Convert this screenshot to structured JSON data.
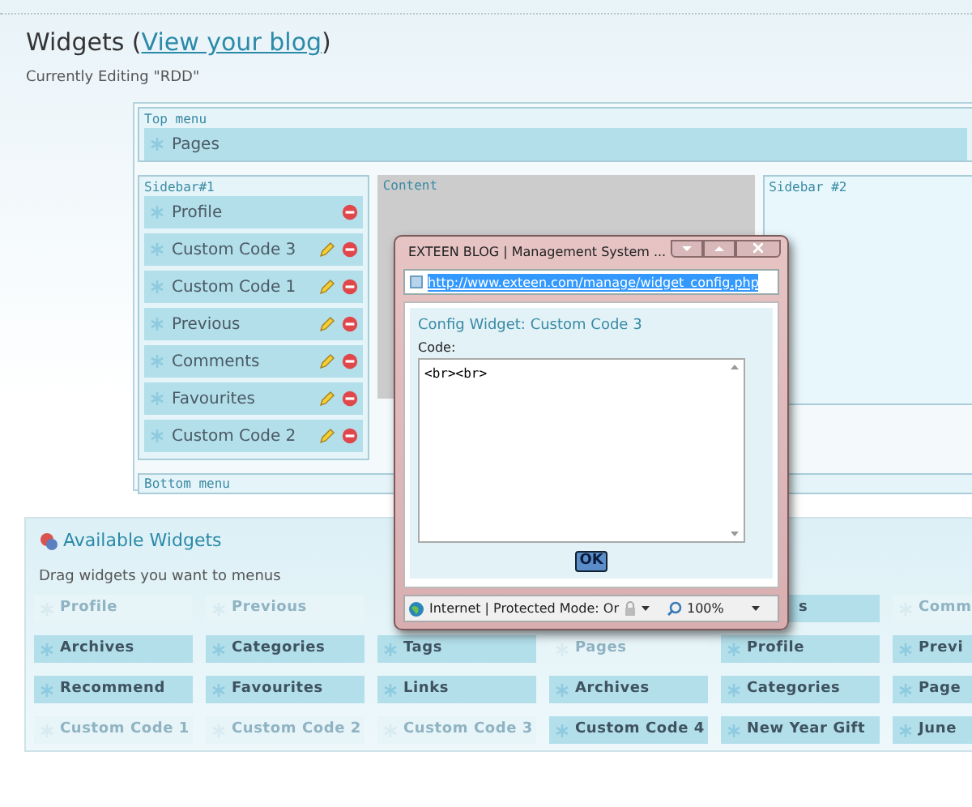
{
  "header": {
    "title_prefix": "Widgets (",
    "link": "View your blog",
    "title_suffix": ")",
    "subtitle": "Currently Editing \"RDD\""
  },
  "layout": {
    "top_menu": {
      "label": "Top menu",
      "items": [
        {
          "label": "Pages",
          "editable": false,
          "removable": false
        }
      ]
    },
    "sidebar_1": {
      "label": "Sidebar#1",
      "items": [
        {
          "label": "Profile",
          "editable": false,
          "removable": true
        },
        {
          "label": "Custom Code 3",
          "editable": true,
          "removable": true
        },
        {
          "label": "Custom Code 1",
          "editable": true,
          "removable": true
        },
        {
          "label": "Previous",
          "editable": true,
          "removable": true
        },
        {
          "label": "Comments",
          "editable": true,
          "removable": true
        },
        {
          "label": "Favourites",
          "editable": true,
          "removable": true
        },
        {
          "label": "Custom Code 2",
          "editable": true,
          "removable": true
        }
      ]
    },
    "content": {
      "label": "Content"
    },
    "sidebar_2": {
      "label": "Sidebar #2"
    },
    "bottom_menu": {
      "label": "Bottom menu"
    }
  },
  "available_widgets": {
    "title": "Available Widgets",
    "hint": "Drag widgets you want to menus",
    "rows": [
      [
        {
          "kind": "widget",
          "label": "Profile",
          "disabled": true
        },
        {
          "kind": "widget",
          "label": "Previous",
          "disabled": true
        },
        {
          "kind": "covered"
        },
        {
          "kind": "covered"
        },
        {
          "kind": "partial",
          "label": "s",
          "disabled": false
        },
        {
          "kind": "widget",
          "label": "Comm",
          "disabled": true
        }
      ],
      [
        {
          "kind": "widget",
          "label": "Archives",
          "disabled": false
        },
        {
          "kind": "widget",
          "label": "Categories",
          "disabled": false
        },
        {
          "kind": "widget",
          "label": "Tags",
          "disabled": false
        },
        {
          "kind": "widget",
          "label": "Pages",
          "disabled": true
        },
        {
          "kind": "widget",
          "label": "Profile",
          "disabled": false
        },
        {
          "kind": "widget",
          "label": "Previ",
          "disabled": false
        }
      ],
      [
        {
          "kind": "widget",
          "label": "Recommend",
          "disabled": false
        },
        {
          "kind": "widget",
          "label": "Favourites",
          "disabled": false
        },
        {
          "kind": "widget",
          "label": "Links",
          "disabled": false
        },
        {
          "kind": "widget",
          "label": "Archives",
          "disabled": false
        },
        {
          "kind": "widget",
          "label": "Categories",
          "disabled": false
        },
        {
          "kind": "widget",
          "label": "Page",
          "disabled": false
        }
      ],
      [
        {
          "kind": "widget",
          "label": "Custom Code 1",
          "disabled": true
        },
        {
          "kind": "widget",
          "label": "Custom Code 2",
          "disabled": true
        },
        {
          "kind": "widget",
          "label": "Custom Code 3",
          "disabled": true
        },
        {
          "kind": "widget",
          "label": "Custom Code 4",
          "disabled": false
        },
        {
          "kind": "widget",
          "label": "New Year Gift",
          "disabled": false
        },
        {
          "kind": "widget",
          "label": "June",
          "disabled": false
        }
      ]
    ]
  },
  "popup": {
    "title": "EXTEEN BLOG | Management System ...",
    "address": "http://www.exteen.com/manage/widget_config.php",
    "heading": "Config Widget: Custom Code 3",
    "code_label": "Code:",
    "code": "<br><br>",
    "ok": "OK",
    "status": "Internet | Protected Mode: Or",
    "zoom": "100%"
  }
}
